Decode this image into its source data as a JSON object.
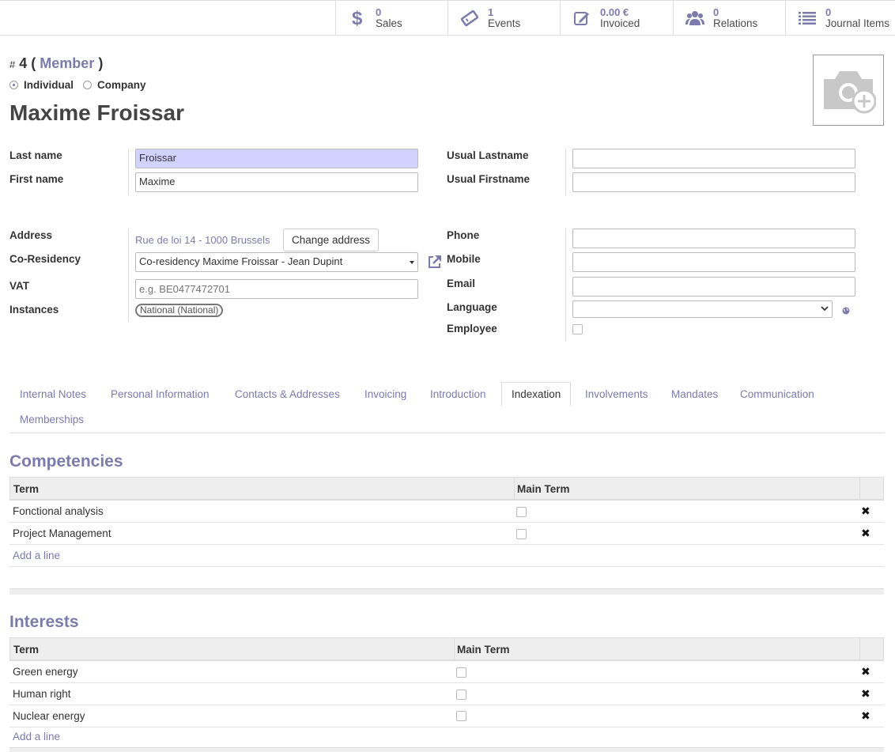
{
  "smart_buttons": [
    {
      "value": "0",
      "label": "Sales",
      "icon": "dollar-icon"
    },
    {
      "value": "1",
      "label": "Events",
      "icon": "ticket-icon"
    },
    {
      "value": "0.00 €",
      "label": "Invoiced",
      "icon": "edit-icon"
    },
    {
      "value": "0",
      "label": "Relations",
      "icon": "users-icon"
    },
    {
      "value": "0",
      "label": "Journal Items",
      "icon": "list-icon"
    }
  ],
  "header": {
    "hash": "#",
    "number": "4",
    "open_paren": "(",
    "state": "Member",
    "close_paren": ")",
    "type_individual": "Individual",
    "type_company": "Company",
    "selected_type": "Individual",
    "name": "Maxime Froissar"
  },
  "fields": {
    "last_name_label": "Last name",
    "last_name": "Froissar",
    "first_name_label": "First name",
    "first_name": "Maxime",
    "usual_lastname_label": "Usual Lastname",
    "usual_lastname": "",
    "usual_firstname_label": "Usual Firstname",
    "usual_firstname": "",
    "address_label": "Address",
    "address": "Rue de loi 14 - 1000 Brussels",
    "change_address": "Change address",
    "coresidency_label": "Co-Residency",
    "coresidency": "Co-residency Maxime Froissar - Jean Dupint",
    "vat_label": "VAT",
    "vat_placeholder": "e.g. BE0477472701",
    "instances_label": "Instances",
    "instance_tag": "National (National)",
    "phone_label": "Phone",
    "phone": "",
    "mobile_label": "Mobile",
    "mobile": "",
    "email_label": "Email",
    "email": "",
    "language_label": "Language",
    "language": "",
    "employee_label": "Employee",
    "employee": false
  },
  "tabs": [
    {
      "label": "Internal Notes"
    },
    {
      "label": "Personal Information"
    },
    {
      "label": "Contacts & Addresses"
    },
    {
      "label": "Invoicing"
    },
    {
      "label": "Introduction"
    },
    {
      "label": "Indexation"
    },
    {
      "label": "Involvements"
    },
    {
      "label": "Mandates"
    },
    {
      "label": "Communication"
    },
    {
      "label": "Memberships"
    }
  ],
  "active_tab": "Indexation",
  "competencies": {
    "title": "Competencies",
    "col_term": "Term",
    "col_main": "Main Term",
    "rows": [
      {
        "term": "Fonctional analysis",
        "main": false
      },
      {
        "term": "Project Management",
        "main": false
      }
    ],
    "add_line": "Add a line"
  },
  "interests": {
    "title": "Interests",
    "col_term": "Term",
    "col_main": "Main Term",
    "rows": [
      {
        "term": "Green energy",
        "main": false
      },
      {
        "term": "Human right",
        "main": false
      },
      {
        "term": "Nuclear energy",
        "main": false
      }
    ],
    "add_line": "Add a line"
  },
  "colors": {
    "accent": "#7c7bad",
    "required_bg": "#d2d2ff"
  }
}
